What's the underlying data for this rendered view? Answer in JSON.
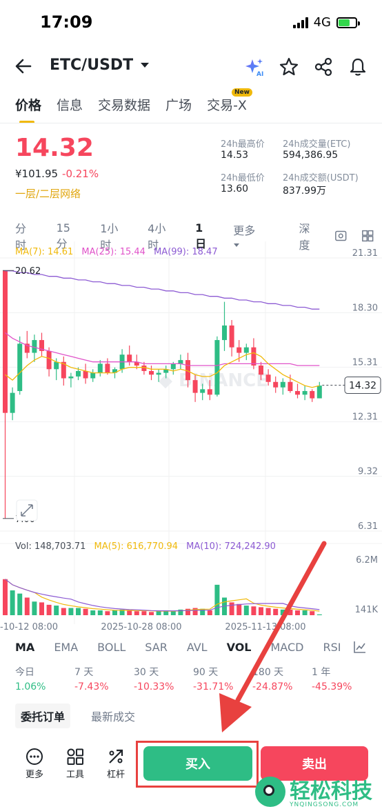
{
  "status": {
    "time": "17:09",
    "network": "4G"
  },
  "header": {
    "pair": "ETC/USDT"
  },
  "tabs": [
    {
      "label": "价格",
      "active": true
    },
    {
      "label": "信息",
      "active": false
    },
    {
      "label": "交易数据",
      "active": false
    },
    {
      "label": "广场",
      "active": false
    },
    {
      "label": "交易-X",
      "active": false,
      "badge": "New"
    }
  ],
  "price": {
    "last": "14.32",
    "cny": "¥101.95",
    "change": "-0.21%",
    "network_tag": "一层/二层网络"
  },
  "stats": [
    {
      "label": "24h最高价",
      "value": "14.53"
    },
    {
      "label": "24h成交量(ETC)",
      "value": "594,386.95"
    },
    {
      "label": "24h最低价",
      "value": "13.60"
    },
    {
      "label": "24h成交额(USDT)",
      "value": "837.99万"
    }
  ],
  "intervals": [
    "分时",
    "15分",
    "1小时",
    "4小时",
    "1日",
    "更多",
    "深度"
  ],
  "selected_interval": "1日",
  "chart_data": {
    "type": "candlestick",
    "ma_legend": [
      {
        "name": "MA(7)",
        "value": "14.61",
        "color": "#f0b90b"
      },
      {
        "name": "MA(25)",
        "value": "15.44",
        "color": "#e052c9"
      },
      {
        "name": "MA(99)",
        "value": "18.47",
        "color": "#8c5ad3"
      }
    ],
    "y_ticks": [
      "21.31",
      "18.30",
      "15.31",
      "12.31",
      "9.32",
      "6.31"
    ],
    "high_label": "20.62",
    "low_label": "7.00",
    "last_price_tag": "14.32",
    "x_labels": [
      "-10-12 08:00",
      "2025-10-28 08:00",
      "2025-11-13 08:00"
    ],
    "candles": [
      [
        20.62,
        20.62,
        7.0,
        12.8
      ],
      [
        12.8,
        14.2,
        12.4,
        13.9
      ],
      [
        14.0,
        17.0,
        13.8,
        16.6
      ],
      [
        16.6,
        17.3,
        15.8,
        16.1
      ],
      [
        16.1,
        17.1,
        15.6,
        16.8
      ],
      [
        16.8,
        17.2,
        15.9,
        16.2
      ],
      [
        16.2,
        16.4,
        14.8,
        15.2
      ],
      [
        15.2,
        15.8,
        14.6,
        15.6
      ],
      [
        15.6,
        15.9,
        14.3,
        14.7
      ],
      [
        14.7,
        15.0,
        14.2,
        14.8
      ],
      [
        14.8,
        15.3,
        14.6,
        15.1
      ],
      [
        15.1,
        15.5,
        14.4,
        14.7
      ],
      [
        14.7,
        15.2,
        14.5,
        15.0
      ],
      [
        15.0,
        15.7,
        14.8,
        15.5
      ],
      [
        15.5,
        15.8,
        14.9,
        15.0
      ],
      [
        15.0,
        15.3,
        14.7,
        15.2
      ],
      [
        15.2,
        16.3,
        15.0,
        16.0
      ],
      [
        16.0,
        16.5,
        15.4,
        15.6
      ],
      [
        15.6,
        16.0,
        15.2,
        15.4
      ],
      [
        15.4,
        15.6,
        14.9,
        15.1
      ],
      [
        15.1,
        15.4,
        14.6,
        14.9
      ],
      [
        14.9,
        15.2,
        14.5,
        15.0
      ],
      [
        15.0,
        15.4,
        14.7,
        15.2
      ],
      [
        15.2,
        15.6,
        14.9,
        15.5
      ],
      [
        15.5,
        16.0,
        15.2,
        15.7
      ],
      [
        15.7,
        16.1,
        14.2,
        14.6
      ],
      [
        14.6,
        14.9,
        13.4,
        13.9
      ],
      [
        13.9,
        14.4,
        13.5,
        14.1
      ],
      [
        14.1,
        14.6,
        13.5,
        13.8
      ],
      [
        13.8,
        17.0,
        13.7,
        16.8
      ],
      [
        16.8,
        18.9,
        16.2,
        17.6
      ],
      [
        17.6,
        17.9,
        15.9,
        16.4
      ],
      [
        16.4,
        16.8,
        15.6,
        16.1
      ],
      [
        16.1,
        16.6,
        15.7,
        16.4
      ],
      [
        16.4,
        16.9,
        15.2,
        15.4
      ],
      [
        15.4,
        15.6,
        14.6,
        14.9
      ],
      [
        14.9,
        15.2,
        14.3,
        14.5
      ],
      [
        14.5,
        14.8,
        13.9,
        14.2
      ],
      [
        14.2,
        14.7,
        13.8,
        14.5
      ],
      [
        14.5,
        14.9,
        13.9,
        14.0
      ],
      [
        14.0,
        14.4,
        13.6,
        13.8
      ],
      [
        13.8,
        14.3,
        13.5,
        14.0
      ],
      [
        14.0,
        14.1,
        13.4,
        13.6
      ],
      [
        13.6,
        14.5,
        13.6,
        14.3
      ]
    ],
    "ma7": [
      14.9,
      14.6,
      15.0,
      15.4,
      15.7,
      15.9,
      15.8,
      15.6,
      15.5,
      15.3,
      15.2,
      15.1,
      15.0,
      15.0,
      15.0,
      15.0,
      15.2,
      15.3,
      15.3,
      15.3,
      15.2,
      15.2,
      15.2,
      15.1,
      15.2,
      15.1,
      14.9,
      14.8,
      14.8,
      15.0,
      15.4,
      15.6,
      15.8,
      16.0,
      16.1,
      15.9,
      15.5,
      15.2,
      14.9,
      14.7,
      14.5,
      14.3,
      14.2,
      14.3
    ],
    "ma25": [
      17.2,
      16.9,
      16.7,
      16.5,
      16.4,
      16.3,
      16.2,
      16.1,
      16.0,
      15.9,
      15.8,
      15.7,
      15.6,
      15.6,
      15.6,
      15.6,
      15.6,
      15.6,
      15.6,
      15.5,
      15.5,
      15.5,
      15.5,
      15.5,
      15.5,
      15.4,
      15.4,
      15.4,
      15.4,
      15.4,
      15.5,
      15.5,
      15.5,
      15.5,
      15.5,
      15.5,
      15.5,
      15.5,
      15.5,
      15.5,
      15.4,
      15.4,
      15.4,
      15.4
    ],
    "ma99": [
      20.6,
      20.6,
      20.5,
      20.5,
      20.4,
      20.4,
      20.3,
      20.3,
      20.2,
      20.2,
      20.1,
      20.1,
      20.0,
      20.0,
      19.9,
      19.9,
      19.8,
      19.8,
      19.7,
      19.7,
      19.6,
      19.6,
      19.5,
      19.5,
      19.4,
      19.4,
      19.3,
      19.3,
      19.2,
      19.2,
      19.1,
      19.1,
      19.0,
      19.0,
      18.9,
      18.9,
      18.8,
      18.8,
      18.7,
      18.7,
      18.6,
      18.6,
      18.5,
      18.5
    ],
    "volume_legend": [
      {
        "name": "Vol",
        "value": "148,703.71",
        "color": "#474d57"
      },
      {
        "name": "MA(5)",
        "value": "616,770.94",
        "color": "#f0b90b"
      },
      {
        "name": "MA(10)",
        "value": "724,242.90",
        "color": "#8c5ad3"
      }
    ],
    "volume_ticks": [
      "6.2M",
      "141K"
    ],
    "volumes": [
      4.5,
      3.1,
      2.7,
      2.2,
      1.7,
      1.6,
      1.3,
      1.2,
      0.9,
      0.9,
      0.9,
      0.8,
      0.6,
      0.6,
      0.5,
      0.6,
      0.7,
      0.6,
      0.5,
      0.5,
      0.4,
      0.5,
      0.6,
      0.5,
      0.7,
      0.8,
      0.9,
      0.8,
      0.6,
      3.8,
      2.2,
      1.6,
      1.4,
      1.2,
      1.1,
      1.0,
      0.9,
      0.8,
      0.7,
      0.7,
      0.6,
      0.6,
      0.5,
      0.1
    ],
    "vol_max": 6.2
  },
  "indicators": [
    "MA",
    "EMA",
    "BOLL",
    "SAR",
    "AVL",
    "VOL",
    "MACD",
    "RSI"
  ],
  "periods": [
    {
      "label": "今日",
      "value": "1.06%"
    },
    {
      "label": "7 天",
      "value": "-7.43%"
    },
    {
      "label": "30 天",
      "value": "-10.33%"
    },
    {
      "label": "90 天",
      "value": "-31.71%"
    },
    {
      "label": "180 天",
      "value": "-24.87%"
    },
    {
      "label": "1 年",
      "value": "-45.39%"
    }
  ],
  "order_tabs": [
    "委托订单",
    "最新成交"
  ],
  "bottom": {
    "more": "更多",
    "tools": "工具",
    "leverage": "杠杆",
    "buy": "买入",
    "sell": "卖出"
  },
  "watermark": {
    "logo_text": "轻松科技",
    "logo_sub": "YNQINGSONG.COM"
  },
  "colors": {
    "up": "#2ebd85",
    "down": "#f6465d",
    "accent": "#f0b90b"
  }
}
